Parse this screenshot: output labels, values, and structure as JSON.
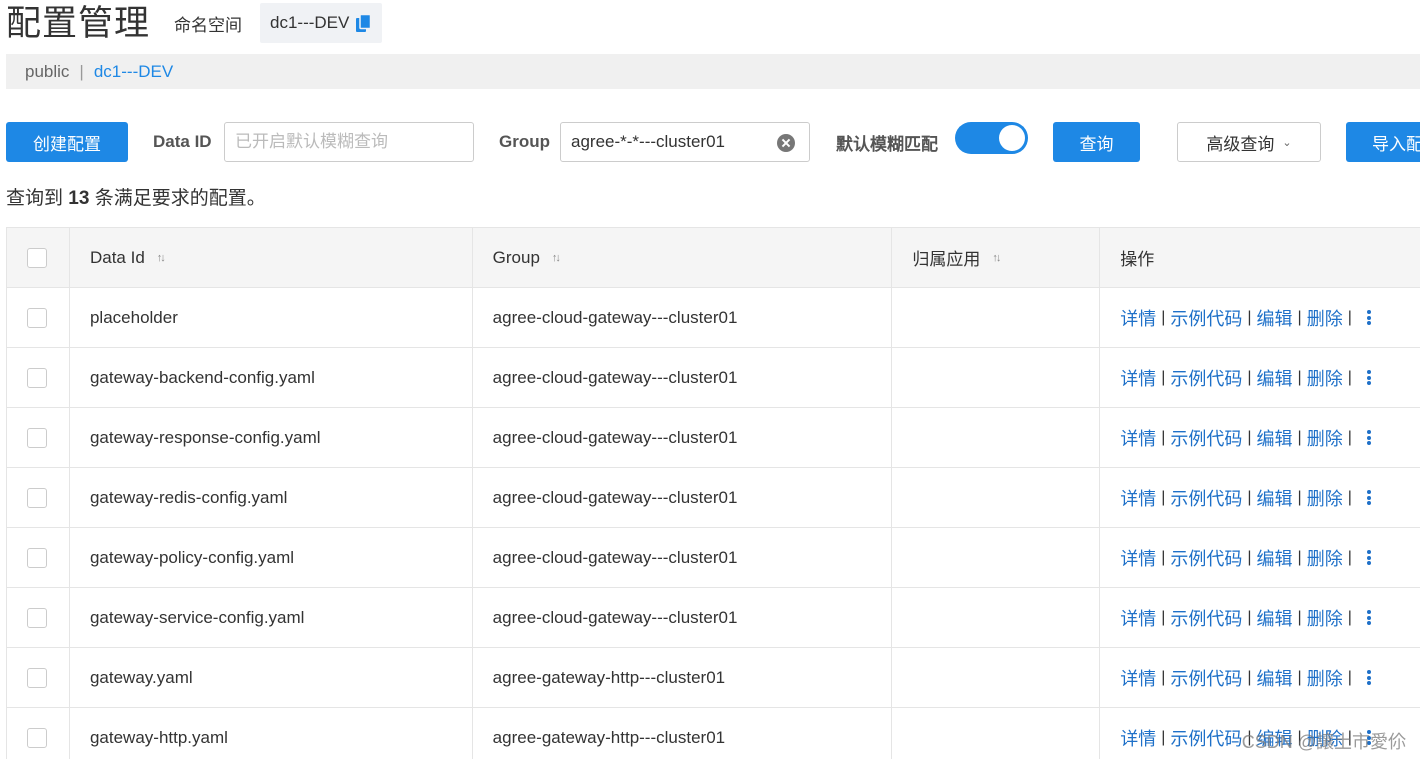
{
  "header": {
    "title": "配置管理",
    "namespace_label": "命名空间",
    "namespace_value": "dc1---DEV"
  },
  "namespace_bar": {
    "items": [
      "public",
      "dc1---DEV"
    ],
    "separator": "|"
  },
  "toolbar": {
    "create_label": "创建配置",
    "data_id_label": "Data ID",
    "data_id_placeholder": "已开启默认模糊查询",
    "group_label": "Group",
    "group_value": "agree-*-*---cluster01",
    "fuzzy_label": "默认模糊匹配",
    "fuzzy_enabled": true,
    "query_label": "查询",
    "advanced_label": "高级查询",
    "import_label": "导入配置"
  },
  "result": {
    "prefix": "查询到",
    "count": "13",
    "suffix": "条满足要求的配置。"
  },
  "table": {
    "columns": [
      "Data Id",
      "Group",
      "归属应用",
      "操作"
    ],
    "actions": [
      "详情",
      "示例代码",
      "编辑",
      "删除"
    ],
    "rows": [
      {
        "data_id": "placeholder",
        "group": "agree-cloud-gateway---cluster01",
        "app": ""
      },
      {
        "data_id": "gateway-backend-config.yaml",
        "group": "agree-cloud-gateway---cluster01",
        "app": ""
      },
      {
        "data_id": "gateway-response-config.yaml",
        "group": "agree-cloud-gateway---cluster01",
        "app": ""
      },
      {
        "data_id": "gateway-redis-config.yaml",
        "group": "agree-cloud-gateway---cluster01",
        "app": ""
      },
      {
        "data_id": "gateway-policy-config.yaml",
        "group": "agree-cloud-gateway---cluster01",
        "app": ""
      },
      {
        "data_id": "gateway-service-config.yaml",
        "group": "agree-cloud-gateway---cluster01",
        "app": ""
      },
      {
        "data_id": "gateway.yaml",
        "group": "agree-gateway-http---cluster01",
        "app": ""
      },
      {
        "data_id": "gateway-http.yaml",
        "group": "agree-gateway-http---cluster01",
        "app": ""
      }
    ]
  },
  "watermark": "CSDN @讓土市愛伱",
  "colors": {
    "primary": "#1e88e5",
    "link": "#1e70c8"
  }
}
